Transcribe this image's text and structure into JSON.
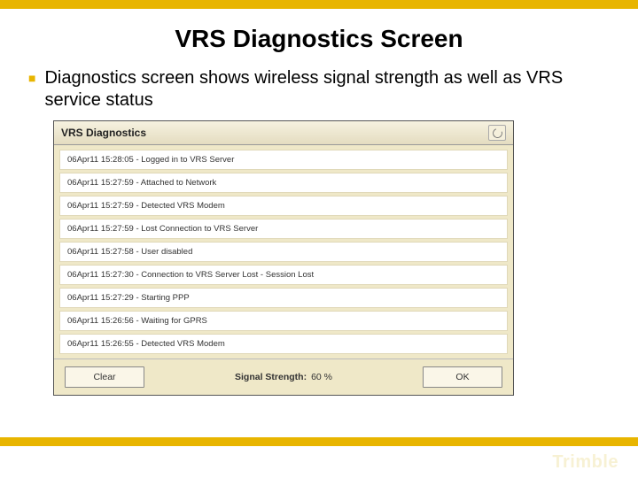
{
  "slide": {
    "title": "VRS Diagnostics Screen",
    "bullet": "Diagnostics screen shows wireless signal strength as well as VRS service status",
    "brand": "Trimble"
  },
  "screenshot": {
    "header_title": "VRS Diagnostics",
    "log_entries": [
      "06Apr11 15:28:05 - Logged in to VRS Server",
      "06Apr11 15:27:59 - Attached to Network",
      "06Apr11 15:27:59 - Detected VRS Modem",
      "06Apr11 15:27:59 - Lost Connection to VRS Server",
      "06Apr11 15:27:58 - User disabled",
      "06Apr11 15:27:30 - Connection to VRS Server Lost - Session Lost",
      "06Apr11 15:27:29 - Starting PPP",
      "06Apr11 15:26:56 - Waiting for GPRS",
      "06Apr11 15:26:55 - Detected VRS Modem"
    ],
    "footer": {
      "clear_label": "Clear",
      "signal_label": "Signal Strength:",
      "signal_value": "60 %",
      "ok_label": "OK"
    }
  }
}
